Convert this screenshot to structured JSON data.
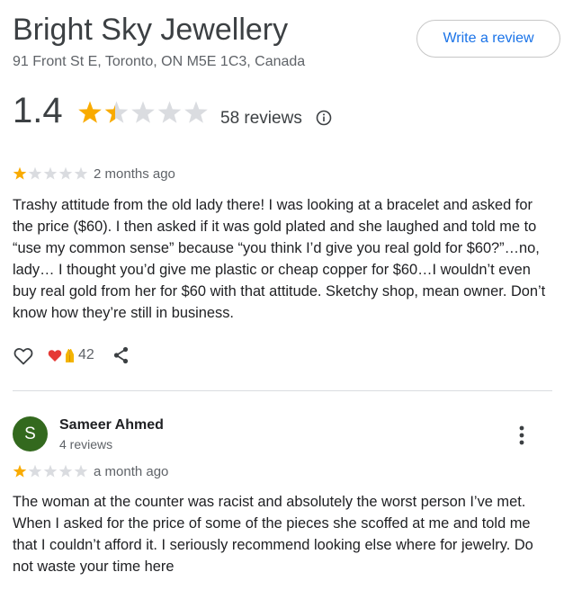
{
  "business": {
    "name": "Bright Sky Jewellery",
    "address": "91 Front St E, Toronto, ON M5E 1C3, Canada",
    "write_review_label": "Write a review"
  },
  "summary": {
    "rating": "1.4",
    "rating_value": 1.4,
    "reviews_count": "58 reviews"
  },
  "colors": {
    "star_filled": "#f9ab00",
    "star_empty": "#dadce0",
    "link_blue": "#1a73e8",
    "avatar_green": "#33691e"
  },
  "reviews": [
    {
      "stars": 1,
      "time": "2 months ago",
      "text": "Trashy attitude from the old lady there! I was looking at a bracelet and asked for the price ($60). I then asked if it was gold plated and she laughed and told me to “use my common sense” because “you think I’d give you real gold for $60?”…no, lady… I thought you’d give me plastic or cheap copper for $60…I wouldn’t even buy real gold from her for $60 with that attitude. Sketchy shop, mean owner. Don’t know how they’re still in business.",
      "reactions": {
        "icons": [
          "heart-emoji",
          "folded-hands-emoji"
        ],
        "count": "42"
      }
    },
    {
      "author": {
        "initial": "S",
        "name": "Sameer Ahmed",
        "meta": "4 reviews"
      },
      "stars": 1,
      "time": "a month ago",
      "text": "The woman at the counter was racist and absolutely the worst person I’ve met. When I asked for the price of some of the pieces she scoffed at me and told me that I couldn’t afford it. I seriously recommend looking else where for jewelry. Do not waste your time here"
    }
  ]
}
